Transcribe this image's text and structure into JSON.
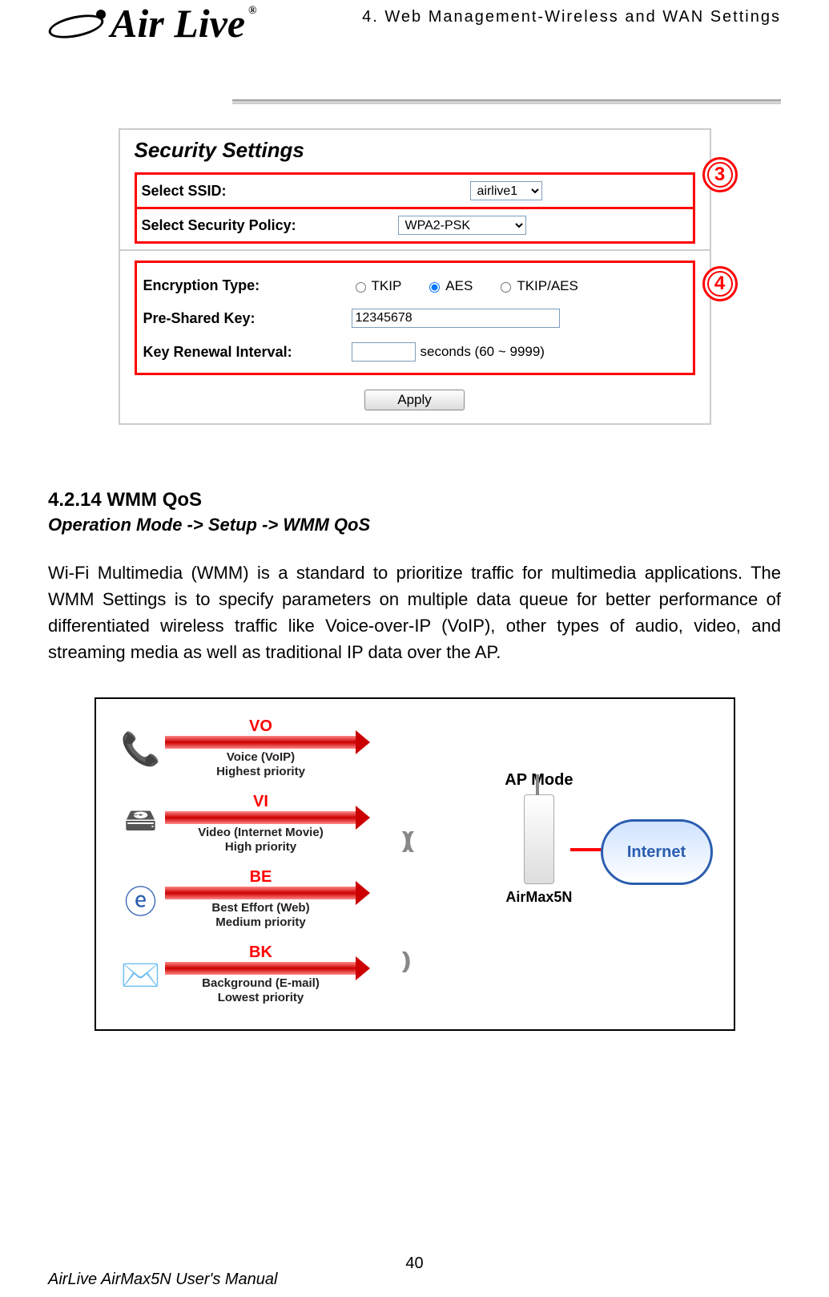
{
  "header": {
    "chapter": "4. Web Management-Wireless and WAN Settings",
    "logo_text": "Air Live",
    "logo_tm": "®"
  },
  "security": {
    "title": "Security Settings",
    "ssid_label": "Select SSID:",
    "ssid_value": "airlive1",
    "policy_label": "Select Security Policy:",
    "policy_value": "WPA2-PSK",
    "enc_label": "Encryption Type:",
    "enc_options": {
      "tkip": "TKIP",
      "aes": "AES",
      "both": "TKIP/AES"
    },
    "psk_label": "Pre-Shared Key:",
    "psk_value": "12345678",
    "kri_label": "Key Renewal Interval:",
    "kri_value": "",
    "kri_suffix": "seconds   (60 ~ 9999)",
    "apply": "Apply",
    "annot3": "3",
    "annot4": "4"
  },
  "section": {
    "heading": "4.2.14 WMM QoS",
    "breadcrumb": "Operation Mode -> Setup -> WMM QoS",
    "paragraph": "Wi-Fi Multimedia (WMM) is a standard to prioritize traffic for multimedia applications. The WMM Settings is to specify parameters on multiple data queue for better performance of differentiated wireless traffic like Voice-over-IP (VoIP), other types of audio, video, and streaming media as well as traditional IP data over the AP."
  },
  "diagram": {
    "vo": {
      "code": "VO",
      "line1": "Voice (VoIP)",
      "line2": "Highest priority"
    },
    "vi": {
      "code": "VI",
      "line1": "Video (Internet Movie)",
      "line2": "High priority"
    },
    "be": {
      "code": "BE",
      "line1": "Best Effort (Web)",
      "line2": "Medium priority"
    },
    "bk": {
      "code": "BK",
      "line1": "Background (E-mail)",
      "line2": "Lowest priority"
    },
    "ap_title": "AP Mode",
    "ap_name": "AirMax5N",
    "internet": "Internet"
  },
  "footer": {
    "page": "40",
    "manual": "AirLive AirMax5N User's Manual"
  }
}
